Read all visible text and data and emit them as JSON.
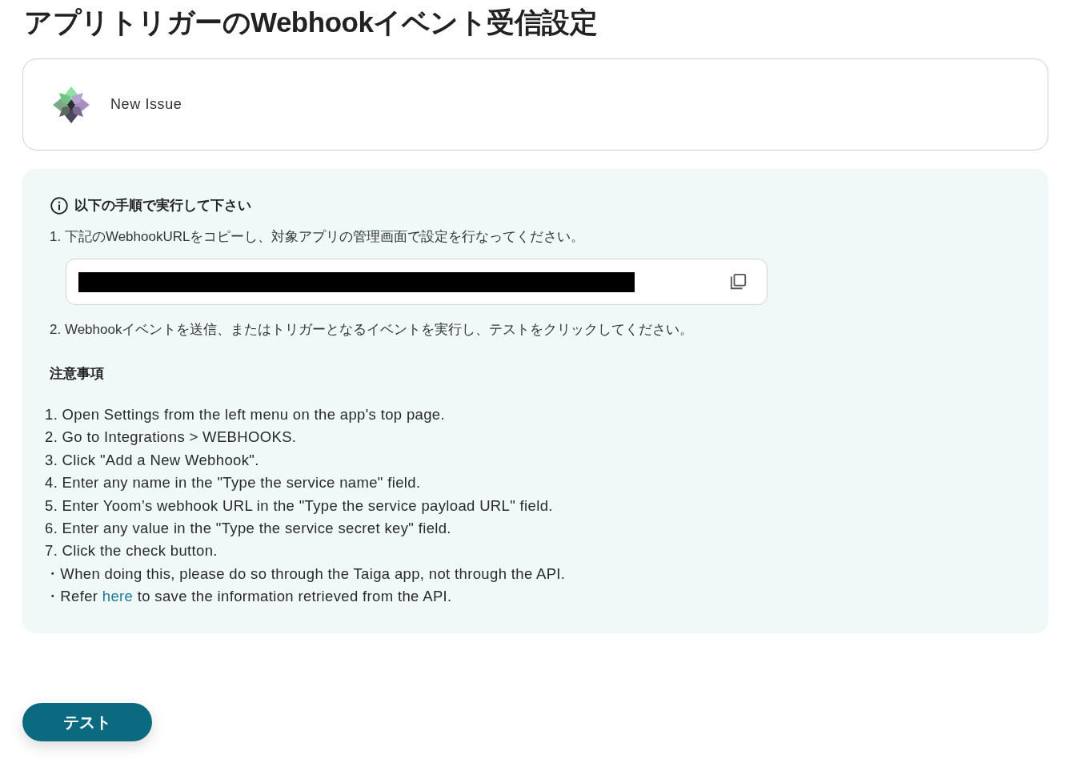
{
  "page_title": "アプリトリガーのWebhookイベント受信設定",
  "trigger": {
    "label": "New Issue"
  },
  "instructions": {
    "heading": "以下の手順で実行して下さい",
    "steps": [
      {
        "kind": "text",
        "text": "1. 下記のWebhookURLをコピーし、対象アプリの管理画面で設定を行なってください。"
      },
      {
        "kind": "url_field",
        "redacted": true
      },
      {
        "kind": "text",
        "text": "2. Webhookイベントを送信、またはトリガーとなるイベントを実行し、テストをクリックしてください。"
      }
    ],
    "notes_heading": "注意事項",
    "notes": [
      {
        "kind": "numbered",
        "text": "1. Open Settings from the left menu on the app's top page."
      },
      {
        "kind": "numbered",
        "text": "2. Go to Integrations > WEBHOOKS."
      },
      {
        "kind": "numbered",
        "text": "3. Click \"Add a New Webhook\"."
      },
      {
        "kind": "numbered",
        "text": "4. Enter any name in the \"Type the service name\" field."
      },
      {
        "kind": "numbered",
        "text": "5. Enter Yoom’s webhook URL in the \"Type the service payload URL\" field."
      },
      {
        "kind": "numbered",
        "text": "6. Enter any value in the \"Type the service secret key\" field."
      },
      {
        "kind": "numbered",
        "text": "7. Click the check button."
      },
      {
        "kind": "bullet",
        "text": "・When doing this, please do so through the Taiga app, not through the API."
      },
      {
        "kind": "bullet_link",
        "before": "・Refer ",
        "link": "here",
        "after": " to save the information retrieved from the API."
      }
    ]
  },
  "test_button": {
    "label": "テスト"
  }
}
